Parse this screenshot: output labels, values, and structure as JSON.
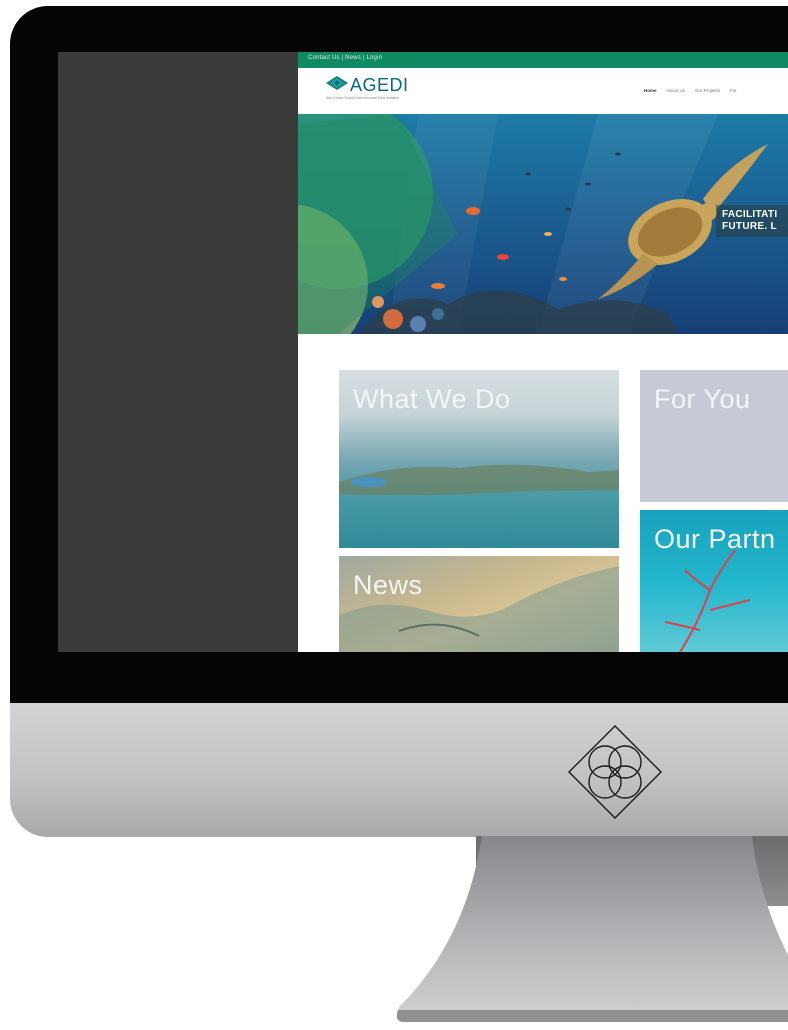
{
  "site": {
    "topbar_links": "Contact Us  |  News  |  Login",
    "logo": {
      "name": "AGEDI",
      "tagline": "Abu Dhabi Global Environmental Data Initiative"
    },
    "nav": [
      "Home",
      "About Us",
      "Our Projects",
      "For"
    ],
    "hero": {
      "caption_line1": "FACILITATI",
      "caption_line2": "FUTURE. L"
    },
    "tiles": {
      "what_we_do": "What We Do",
      "for_you": "For You",
      "news": "News",
      "our_partners": "Our Partn"
    }
  },
  "colors": {
    "brand_green": "#0f8a63",
    "logo_teal": "#0b6b78",
    "bezel": "#050505",
    "chin": "#c4c5c7"
  },
  "icons": [
    "agedi-logo-icon",
    "agedi-emblem-icon"
  ]
}
